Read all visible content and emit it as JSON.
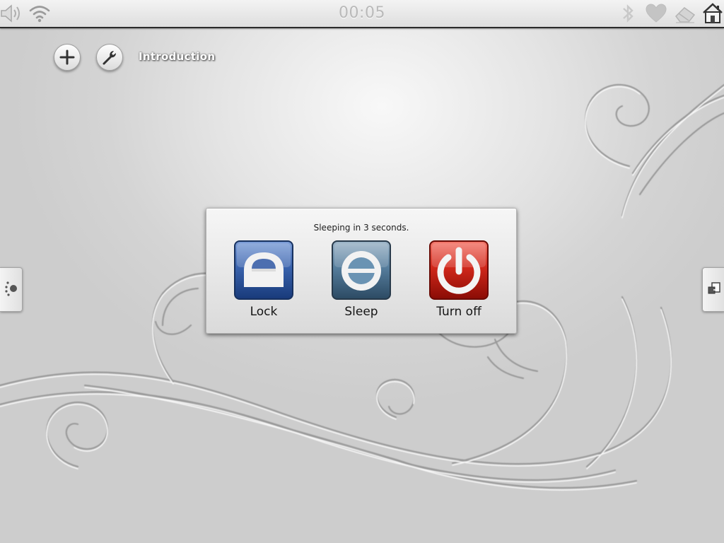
{
  "statusbar": {
    "clock": "00:05",
    "left_icons": [
      "volume-icon",
      "wifi-icon"
    ],
    "right_icons": [
      "bluetooth-icon",
      "heart-icon",
      "eraser-icon",
      "home-icon"
    ]
  },
  "toolbar": {
    "add_icon": "plus-icon",
    "settings_icon": "wrench-icon",
    "title": "Introduction"
  },
  "side_tabs": {
    "left_icon": "dots-icon",
    "right_icon": "window-switch-icon"
  },
  "power_dialog": {
    "message": "Sleeping in 3 seconds.",
    "buttons": [
      {
        "label": "Lock",
        "icon": "lock-icon",
        "color": "#2f5aa5"
      },
      {
        "label": "Sleep",
        "icon": "sleep-icon",
        "color": "#4f7896"
      },
      {
        "label": "Turn off",
        "icon": "power-icon",
        "color": "#c8190f"
      }
    ]
  }
}
